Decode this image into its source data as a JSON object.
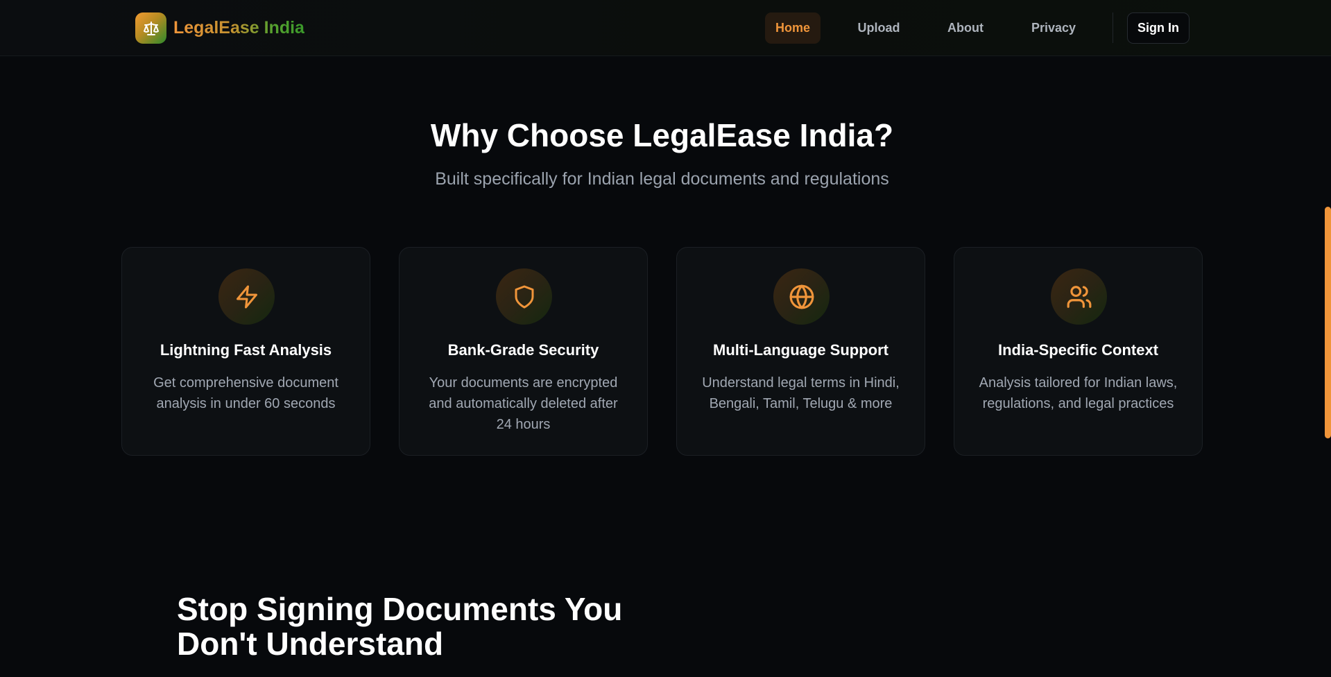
{
  "nav": {
    "brand": "LegalEase India",
    "links": [
      {
        "label": "Home",
        "active": true
      },
      {
        "label": "Upload",
        "active": false
      },
      {
        "label": "About",
        "active": false
      },
      {
        "label": "Privacy",
        "active": false
      }
    ],
    "signin": "Sign In"
  },
  "features": {
    "title": "Why Choose LegalEase India?",
    "subtitle": "Built specifically for Indian legal documents and regulations",
    "cards": [
      {
        "icon": "lightning-icon",
        "title": "Lightning Fast Analysis",
        "desc": "Get comprehensive document analysis in under 60 seconds"
      },
      {
        "icon": "shield-icon",
        "title": "Bank-Grade Security",
        "desc": "Your documents are encrypted and automatically deleted after 24 hours"
      },
      {
        "icon": "globe-icon",
        "title": "Multi-Language Support",
        "desc": "Understand legal terms in Hindi, Bengali, Tamil, Telugu & more"
      },
      {
        "icon": "users-icon",
        "title": "India-Specific Context",
        "desc": "Analysis tailored for Indian laws, regulations, and legal practices"
      }
    ]
  },
  "cta": {
    "title": "Stop Signing Documents You Don't Understand"
  },
  "colors": {
    "accent": "#f0953a",
    "green": "#3a9a2a",
    "background": "#07090c"
  }
}
